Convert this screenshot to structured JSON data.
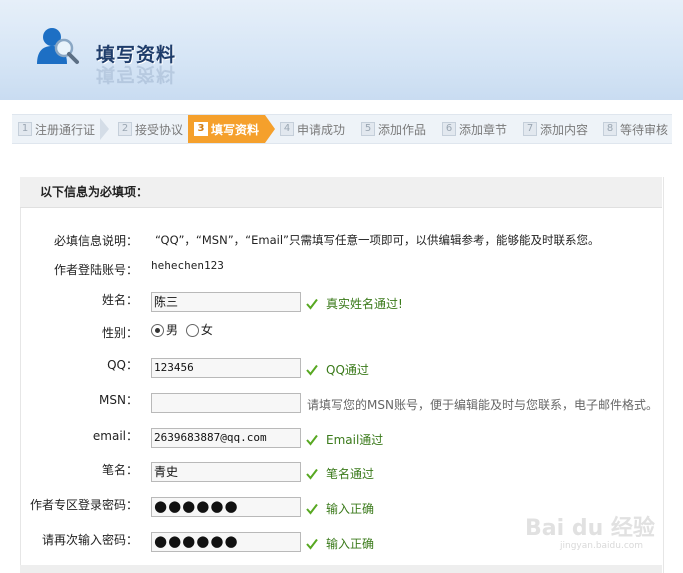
{
  "header": {
    "title": "填写资料"
  },
  "steps": [
    {
      "num": "1",
      "label": "注册通行证"
    },
    {
      "num": "2",
      "label": "接受协议"
    },
    {
      "num": "3",
      "label": "填写资料"
    },
    {
      "num": "4",
      "label": "申请成功"
    },
    {
      "num": "5",
      "label": "添加作品"
    },
    {
      "num": "6",
      "label": "添加章节"
    },
    {
      "num": "7",
      "label": "添加内容"
    },
    {
      "num": "8",
      "label": "等待审核"
    }
  ],
  "form": {
    "section_title": "以下信息为必填项：",
    "note_label": "必填信息说明：",
    "note_text": "“QQ”，“MSN”，“Email”只需填写任意一项即可，以供编辑参考，能够能及时联系您。",
    "account_label": "作者登陆账号：",
    "account_value": "hehechen123",
    "name_label": "姓名：",
    "name_value": "陈三",
    "name_tip": "真实姓名通过!",
    "gender_label": "性别：",
    "gender_male": "男",
    "gender_female": "女",
    "qq_label": "QQ：",
    "qq_value": "123456",
    "qq_tip": "QQ通过",
    "msn_label": "MSN：",
    "msn_value": "",
    "msn_hint": "请填写您的MSN账号，便于编辑能及时与您联系，电子邮件格式。",
    "email_label": "email：",
    "email_value": "2639683887@qq.com",
    "email_tip": "Email通过",
    "penname_label": "笔名：",
    "penname_value": "青史",
    "penname_tip": "笔名通过",
    "password_label": "作者专区登录密码：",
    "password_mask": "●●●●●●",
    "password_tip": "输入正确",
    "password2_label": "请再次输入密码：",
    "password2_mask": "●●●●●●",
    "password2_tip": "输入正确"
  },
  "watermark": {
    "text": "Bai du 经验",
    "sub": "jingyan.baidu.com"
  },
  "colors": {
    "active_step": "#f5a02c",
    "ok_text": "#3a7a1a",
    "header_blue": "#1f3d6b"
  }
}
